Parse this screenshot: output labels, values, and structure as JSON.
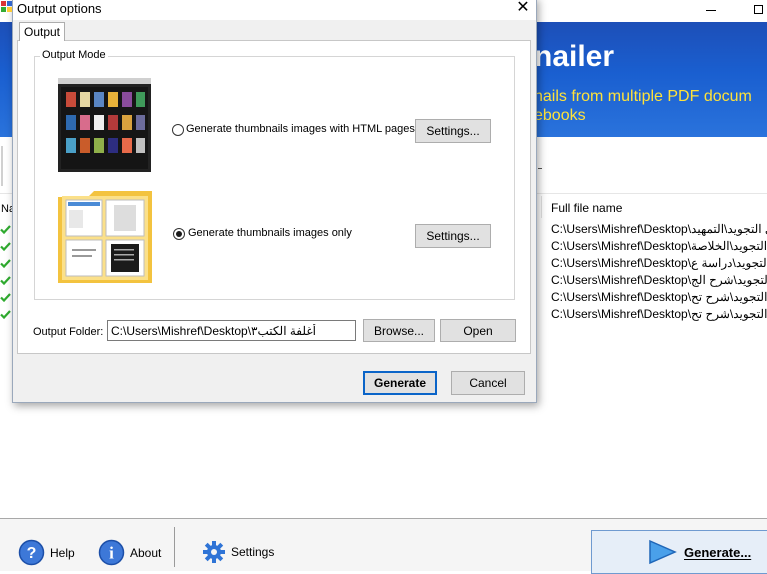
{
  "main_window": {
    "banner": {
      "title": "nailer",
      "subtitle_line1": "nails from multiple PDF docum",
      "subtitle_line2": "ebooks"
    },
    "file_list": {
      "header_left": "Na",
      "header_full_file_name": "Full file name",
      "rows": [
        "C:\\Users\\Mishref\\Desktop\\ي التجويد\\التمهيد",
        "C:\\Users\\Mishref\\Desktop\\ي التجويد\\الخلاصة",
        "C:\\Users\\Mishref\\Desktop\\ي التجويد\\دراسة ع",
        "C:\\Users\\Mishref\\Desktop\\ي التجويد\\شرح الج",
        "C:\\Users\\Mishref\\Desktop\\ي التجويد\\شرح تح",
        "C:\\Users\\Mishref\\Desktop\\ي التجويد\\شرح تح"
      ]
    },
    "bottom_bar": {
      "help_label": "Help",
      "about_label": "About",
      "settings_label": "Settings",
      "generate_label": "Generate..."
    }
  },
  "dialog": {
    "title": "Output options",
    "close_glyph": "✕",
    "tab_label": "Output",
    "group_label": "Output Mode",
    "mode_html": {
      "label": "Generate thumbnails images with HTML pages",
      "selected": false,
      "settings_label": "Settings..."
    },
    "mode_images": {
      "label": "Generate thumbnails images only",
      "selected": true,
      "settings_label": "Settings..."
    },
    "output_folder": {
      "label": "Output Folder:",
      "value": "C:\\Users\\Mishref\\Desktop\\أغلفة الكتب٣",
      "browse_label": "Browse...",
      "open_label": "Open"
    },
    "generate_label": "Generate",
    "cancel_label": "Cancel"
  },
  "colors": {
    "banner_blue": "#1a5fd0",
    "banner_yellow_text": "#ffe23a",
    "check_green": "#2faa2f",
    "default_button_border": "#0a64c8"
  }
}
